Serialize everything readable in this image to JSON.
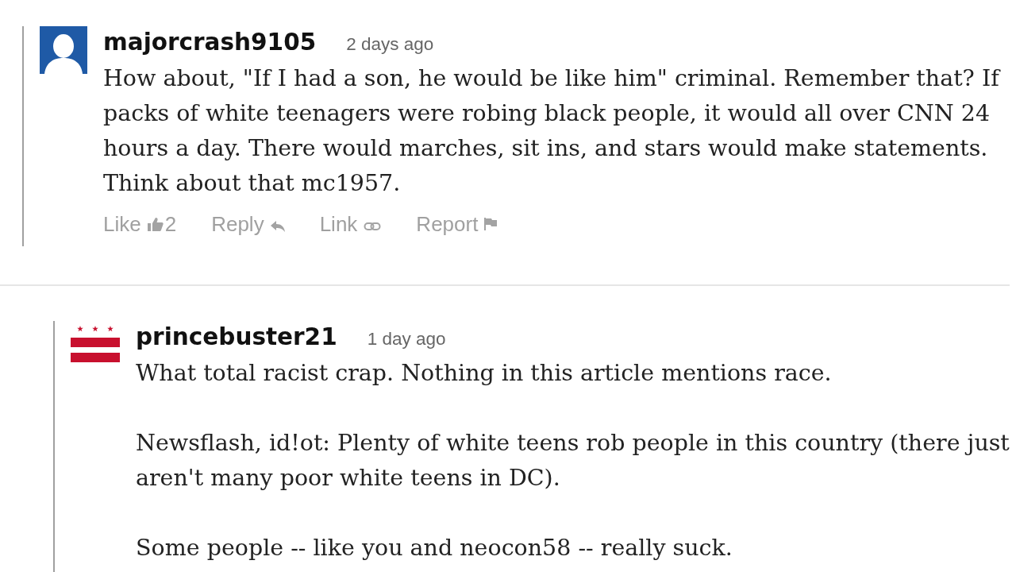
{
  "comments": [
    {
      "user": "majorcrash9105",
      "time": "2 days ago",
      "paragraphs": [
        "How about, \"If I had a son, he would be like him\" criminal. Remember that? If packs of white teenagers were robing black people, it would all over CNN 24 hours a day. There would marches, sit ins, and stars would make statements. Think about that mc1957."
      ],
      "actions": [
        {
          "kind": "like",
          "label": "Like",
          "count": "2"
        },
        {
          "kind": "reply",
          "label": "Reply"
        },
        {
          "kind": "link",
          "label": "Link"
        },
        {
          "kind": "report",
          "label": "Report"
        }
      ],
      "children": [
        {
          "user": "princebuster21",
          "time": "1 day ago",
          "paragraphs": [
            "What total racist crap. Nothing in this article mentions race.",
            "Newsflash, id!ot: Plenty of white teens rob people in this country (there just aren't many poor white teens in DC).",
            "Some people -- like you and neocon58 -- really suck."
          ]
        }
      ]
    }
  ]
}
